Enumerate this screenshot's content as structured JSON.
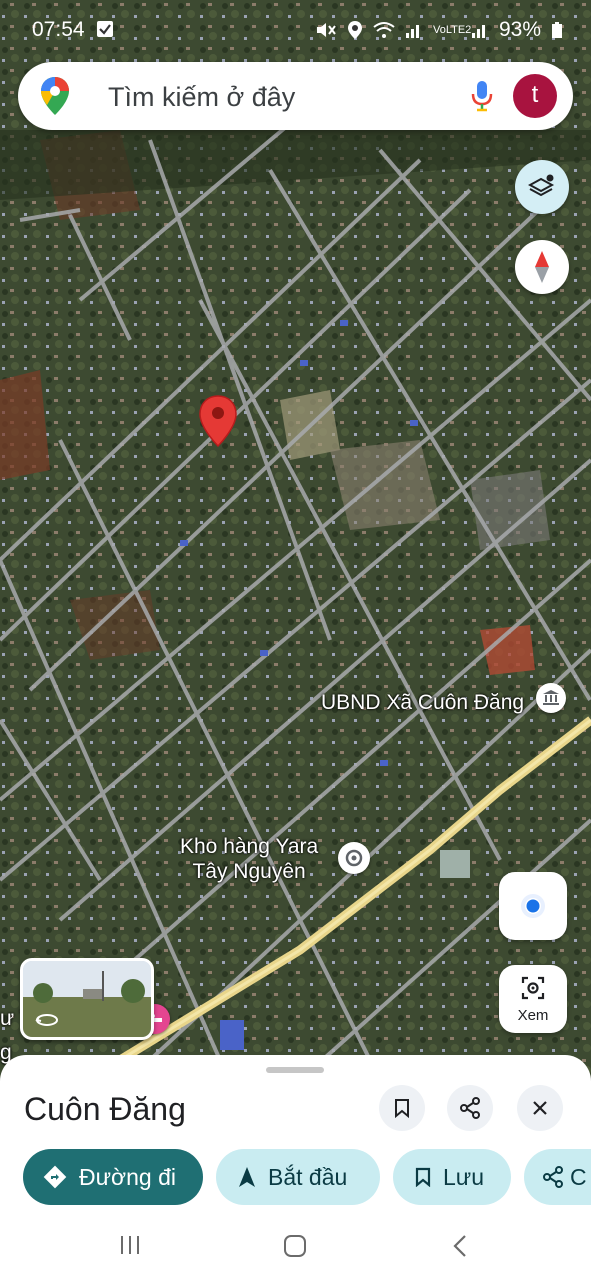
{
  "status_bar": {
    "time": "07:54",
    "battery": "93%",
    "network": "VoLTE2"
  },
  "search": {
    "placeholder": "Tìm kiếm ở đây",
    "avatar_letter": "t"
  },
  "map": {
    "labels": {
      "ubnd": "UBND Xã Cuôn Đăng",
      "kho_line1": "Kho hàng Yara",
      "kho_line2": "Tây Nguyên",
      "left_edge_1": "ư T",
      "left_edge_2": "g"
    },
    "locate_label": "Xem"
  },
  "sheet": {
    "title": "Cuôn Đăng",
    "chips": {
      "directions": "Đường đi",
      "start": "Bắt đầu",
      "save": "Lưu",
      "share": "C"
    }
  },
  "colors": {
    "accent": "#1f6f73",
    "chip_bg": "#c9ecf1",
    "pin": "#e53935",
    "avatar": "#a8133f",
    "road_highlight": "#e8d58a"
  }
}
